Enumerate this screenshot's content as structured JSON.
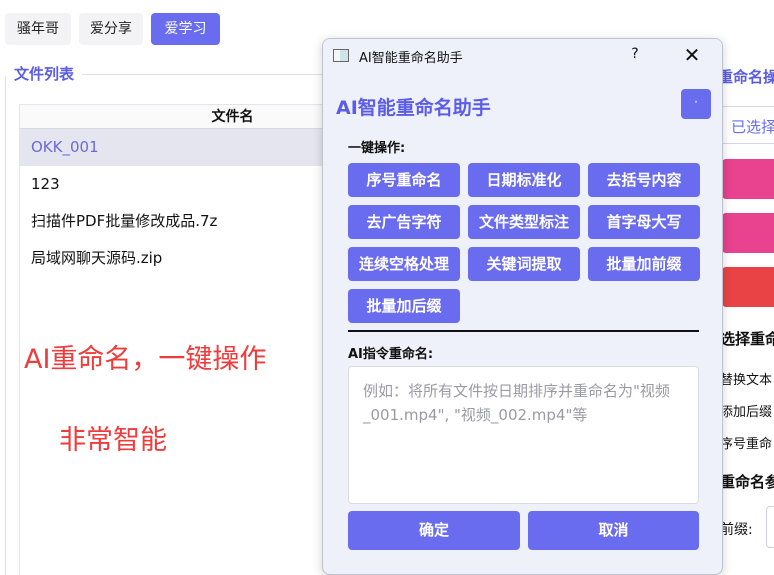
{
  "top_tabs": [
    {
      "label": "骚年哥"
    },
    {
      "label": "爱分享"
    },
    {
      "label": "爱学习"
    }
  ],
  "file_list": {
    "title": "文件列表",
    "column_header": "文件名",
    "rows": [
      {
        "name": "OKK_001"
      },
      {
        "name": "123"
      },
      {
        "name": "扫描件PDF批量修改成品.7z"
      },
      {
        "name": "局域网聊天源码.zip"
      }
    ]
  },
  "annotations": {
    "line1": "AI重命名，一键操作",
    "line2": "非常智能",
    "color": "#ef3b3b"
  },
  "right_panel": {
    "title": "重命名操",
    "selected_text": "已选择",
    "bar_colors": [
      "#e9428f",
      "#e9428f",
      "#ea4345"
    ],
    "section1": "选择重命",
    "options": [
      "替换文本",
      "添加后缀",
      "序号重命"
    ],
    "section2": "重命名参",
    "prefix_label": "前缀:"
  },
  "dialog": {
    "window_title": "AI智能重命名助手",
    "help_label": "?",
    "close_label": "✕",
    "heading": "AI智能重命名助手",
    "dot_button_label": "·",
    "quick_ops_label": "一键操作:",
    "quick_ops": [
      "序号重命名",
      "日期标准化",
      "去括号内容",
      "去广告字符",
      "文件类型标注",
      "首字母大写",
      "连续空格处理",
      "关键词提取",
      "批量加前缀",
      "批量加后缀"
    ],
    "ai_command_label": "AI指令重命名:",
    "prompt_placeholder": "例如：将所有文件按日期排序并重命名为\"视频_001.mp4\", \"视频_002.mp4\"等",
    "confirm_label": "确定",
    "cancel_label": "取消",
    "accent_color": "#6a6cf0"
  }
}
